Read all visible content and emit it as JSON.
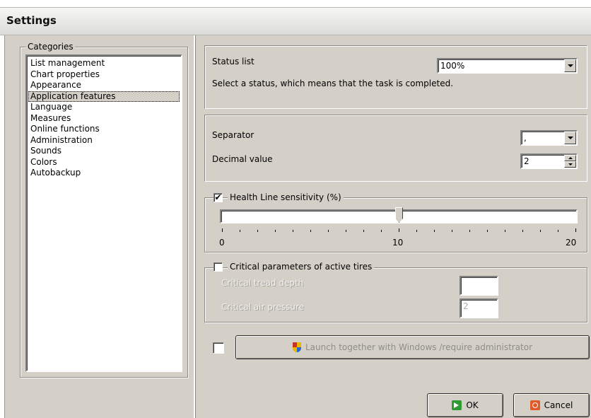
{
  "window": {
    "title": "Settings"
  },
  "categories": {
    "legend": "Categories",
    "items": [
      "List management",
      "Chart properties",
      "Appearance",
      "Application features",
      "Language",
      "Measures",
      "Online functions",
      "Administration",
      "Sounds",
      "Colors",
      "Autobackup"
    ],
    "selected_index": 3
  },
  "status": {
    "label": "Status list",
    "selected": "100%",
    "description": "Select a status, which means that the task is completed."
  },
  "number_format": {
    "separator_label": "Separator",
    "separator_value": ",",
    "decimal_label": "Decimal value",
    "decimal_value": "2"
  },
  "health_line": {
    "checked": true,
    "check_mark": "✔",
    "legend": "Health Line sensitivity (%)",
    "slider_value": 10,
    "slider_min": 0,
    "slider_max": 20,
    "label_min": "0",
    "label_mid": "10",
    "label_max": "20"
  },
  "critical": {
    "checked": false,
    "legend": "Critical parameters of active tires",
    "tread_label": "Critical tread depth",
    "tread_value": "",
    "pressure_label": "Critical air pressure",
    "pressure_value": "2"
  },
  "launch": {
    "checked": false,
    "button_label": "Launch together with Windows /require administrator"
  },
  "buttons": {
    "ok": "OK",
    "cancel": "Cancel"
  }
}
